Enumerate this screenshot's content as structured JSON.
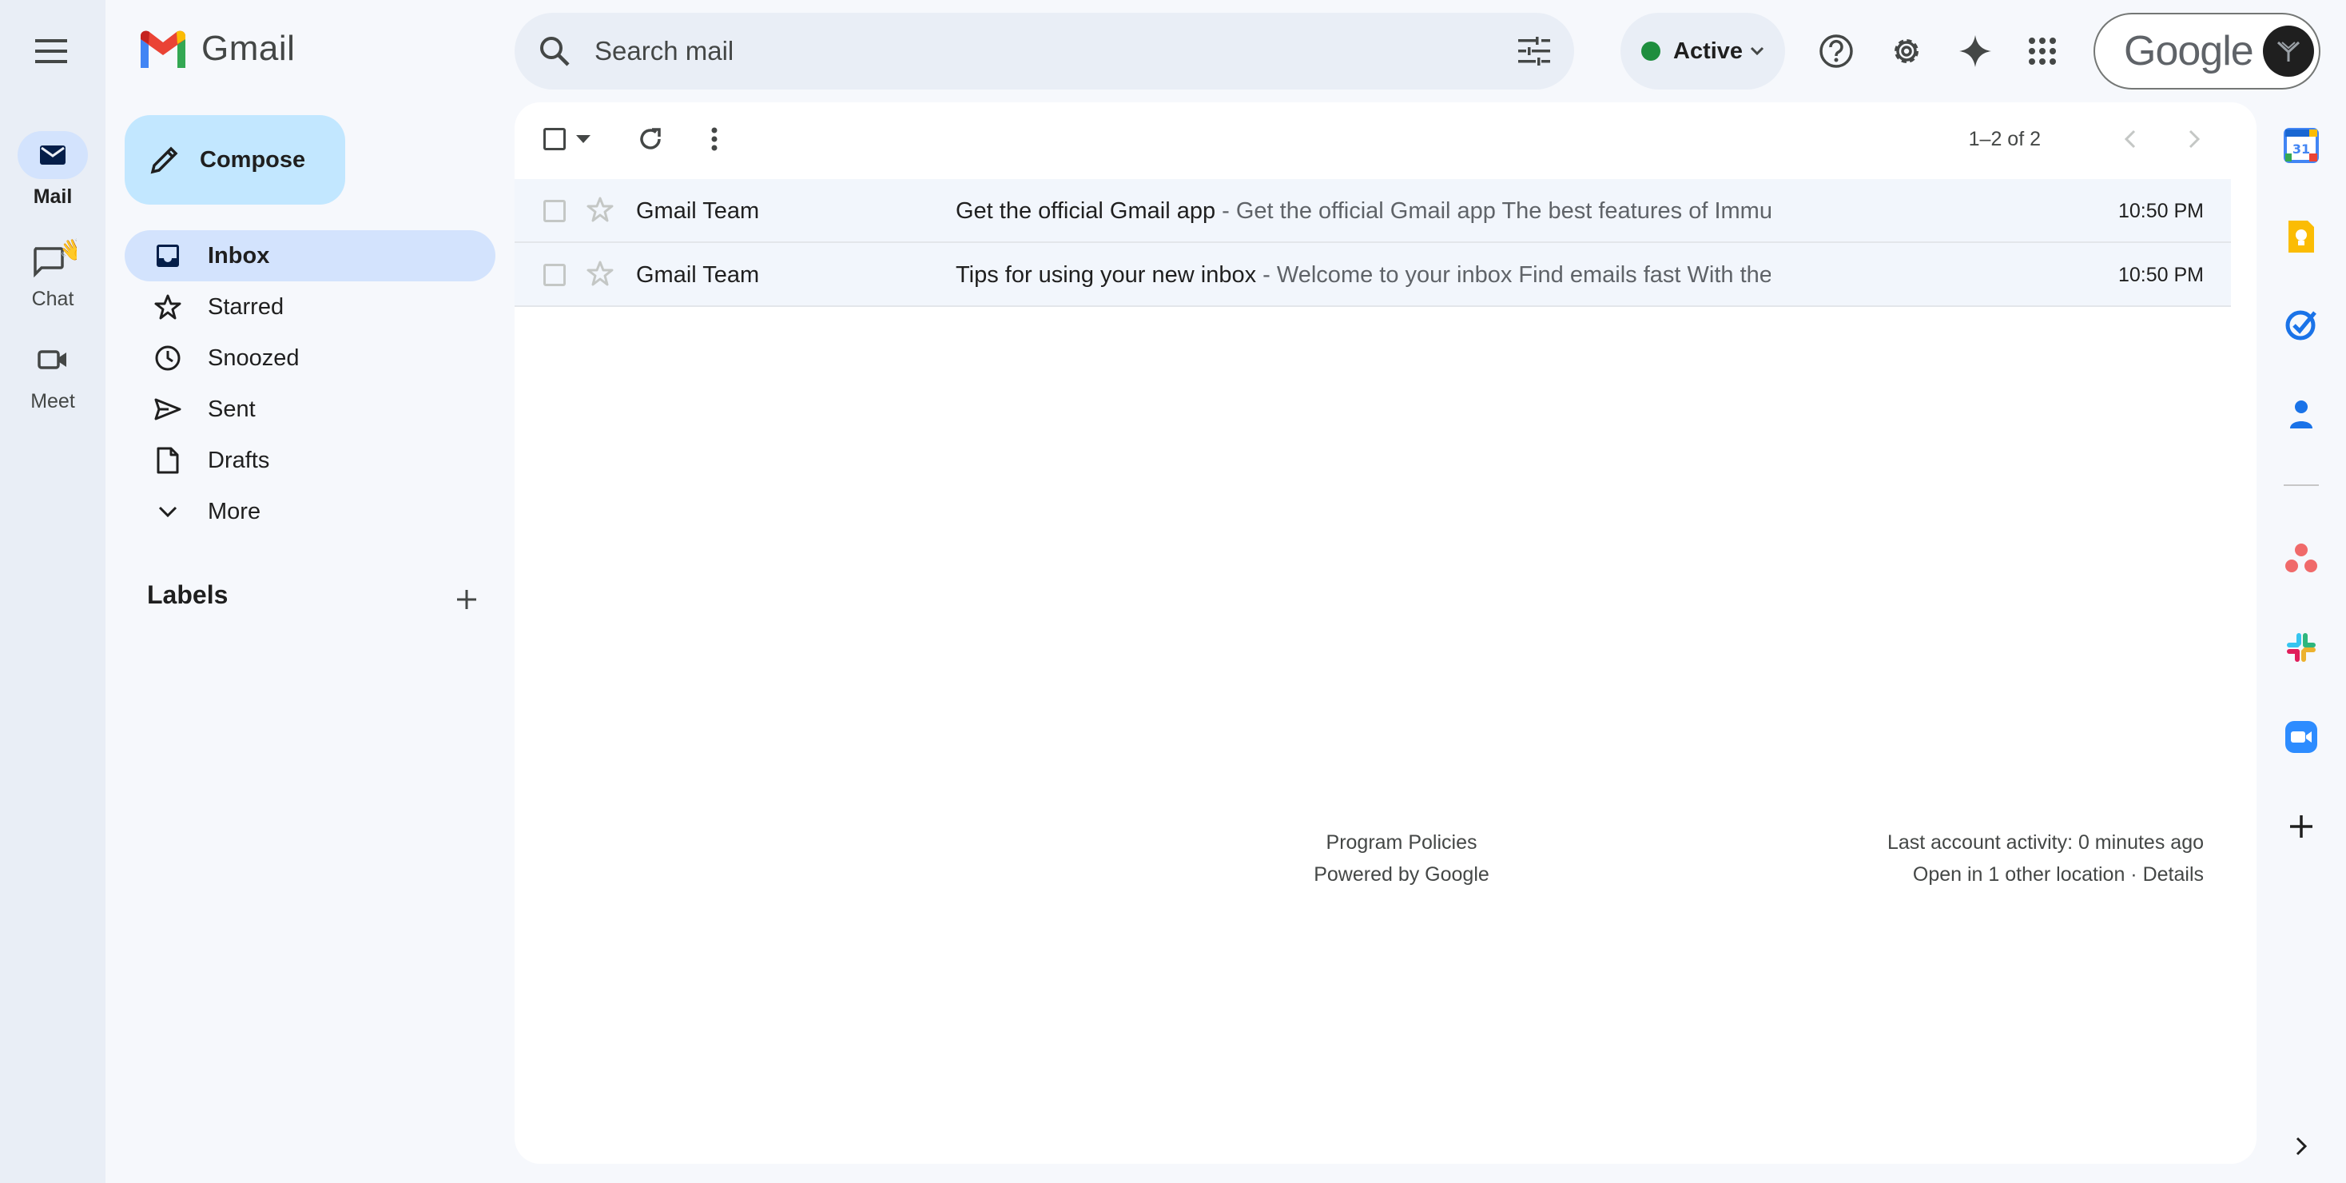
{
  "rail": {
    "items": [
      {
        "label": "Mail",
        "icon": "mail-icon",
        "active": true
      },
      {
        "label": "Chat",
        "icon": "chat-icon",
        "active": false
      },
      {
        "label": "Meet",
        "icon": "video-icon",
        "active": false
      }
    ]
  },
  "logo": {
    "text": "Gmail"
  },
  "search": {
    "placeholder": "Search mail"
  },
  "status": {
    "label": "Active",
    "color": "#1e8e3e"
  },
  "account": {
    "brand": "Google"
  },
  "compose": {
    "label": "Compose"
  },
  "nav": {
    "items": [
      {
        "label": "Inbox",
        "icon": "inbox-icon",
        "active": true
      },
      {
        "label": "Starred",
        "icon": "star-icon"
      },
      {
        "label": "Snoozed",
        "icon": "clock-icon"
      },
      {
        "label": "Sent",
        "icon": "send-icon"
      },
      {
        "label": "Drafts",
        "icon": "draft-icon"
      },
      {
        "label": "More",
        "icon": "chevron-down-icon"
      }
    ]
  },
  "labels": {
    "heading": "Labels"
  },
  "toolbar": {
    "count": "1–2 of 2"
  },
  "emails": [
    {
      "sender": "Gmail Team",
      "subject": "Get the official Gmail app",
      "separator": " - ",
      "snippet": "Get the official Gmail app The best features of Immunai Mail are only available ...",
      "time": "10:50 PM"
    },
    {
      "sender": "Gmail Team",
      "subject": "Tips for using your new inbox",
      "separator": " - ",
      "snippet": "Welcome to your inbox Find emails fast With the power of Google Search in ...",
      "time": "10:50 PM"
    }
  ],
  "footer": {
    "program_policies": "Program Policies",
    "powered_by": "Powered by Google",
    "last_activity": "Last account activity: 0 minutes ago",
    "other_location": "Open in 1 other location",
    "dot": " · ",
    "details": "Details"
  },
  "side_panel": {
    "calendar_day": "31",
    "icons": [
      "calendar-icon",
      "keep-icon",
      "tasks-icon",
      "contacts-icon",
      "asana-icon",
      "slack-icon",
      "zoom-icon",
      "add-icon",
      "chevron-right-icon"
    ]
  },
  "colors": {
    "accent": "#0b57d0",
    "nav_active": "#d3e3fd",
    "compose_bg": "#c2e7ff",
    "background": "#f6f8fc"
  }
}
